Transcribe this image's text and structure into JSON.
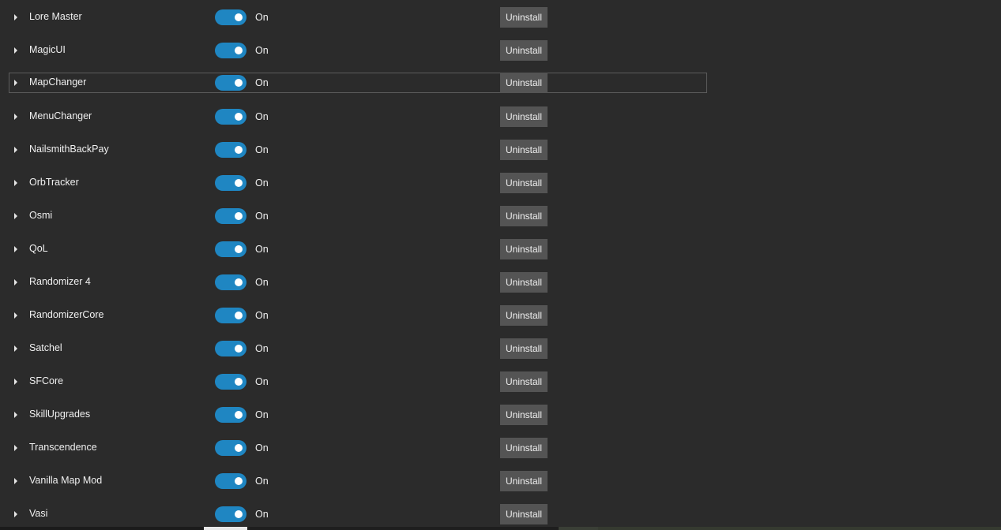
{
  "mods": [
    {
      "name": "Lore Master",
      "state": "On",
      "action": "Uninstall"
    },
    {
      "name": "MagicUI",
      "state": "On",
      "action": "Uninstall"
    },
    {
      "name": "MapChanger",
      "state": "On",
      "action": "Uninstall"
    },
    {
      "name": "MenuChanger",
      "state": "On",
      "action": "Uninstall"
    },
    {
      "name": "NailsmithBackPay",
      "state": "On",
      "action": "Uninstall"
    },
    {
      "name": "OrbTracker",
      "state": "On",
      "action": "Uninstall"
    },
    {
      "name": "Osmi",
      "state": "On",
      "action": "Uninstall"
    },
    {
      "name": "QoL",
      "state": "On",
      "action": "Uninstall"
    },
    {
      "name": "Randomizer 4",
      "state": "On",
      "action": "Uninstall"
    },
    {
      "name": "RandomizerCore",
      "state": "On",
      "action": "Uninstall"
    },
    {
      "name": "Satchel",
      "state": "On",
      "action": "Uninstall"
    },
    {
      "name": "SFCore",
      "state": "On",
      "action": "Uninstall"
    },
    {
      "name": "SkillUpgrades",
      "state": "On",
      "action": "Uninstall"
    },
    {
      "name": "Transcendence",
      "state": "On",
      "action": "Uninstall"
    },
    {
      "name": "Vanilla Map Mod",
      "state": "On",
      "action": "Uninstall"
    },
    {
      "name": "Vasi",
      "state": "On",
      "action": "Uninstall"
    }
  ],
  "colors": {
    "background": "#2b2b2b",
    "toggle_on": "#1f86c2",
    "button": "#545454",
    "text": "#f0f0f0",
    "selection_border": "#5c5c5c"
  },
  "icons": {
    "expander": "caret-right-icon",
    "toggle_knob": "toggle-knob-icon"
  }
}
